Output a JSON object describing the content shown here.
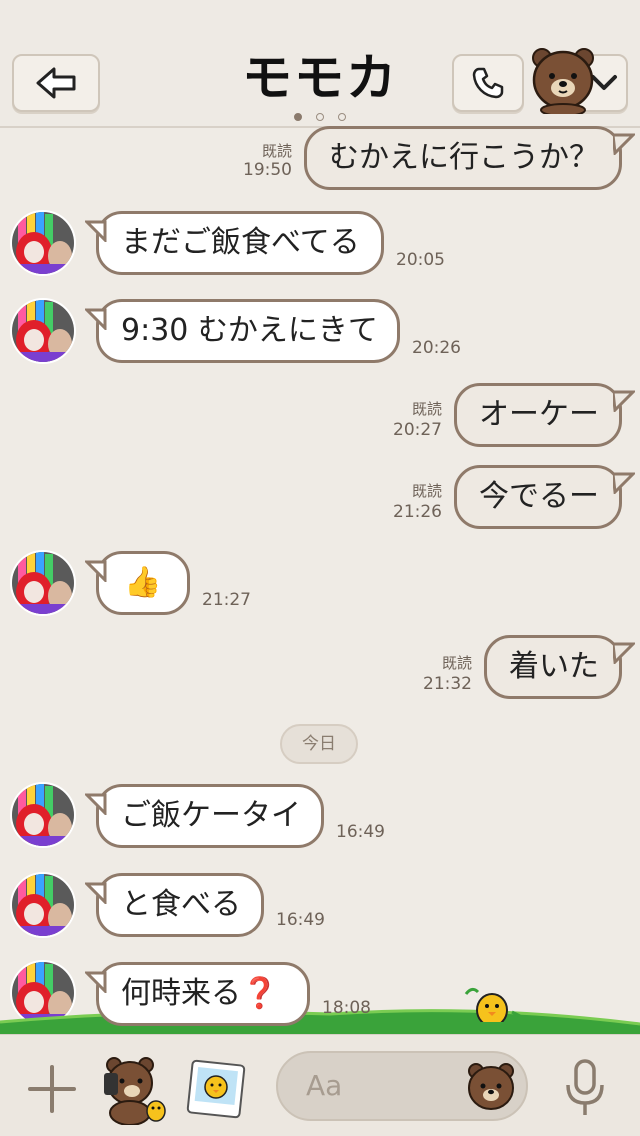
{
  "header": {
    "title": "モモカ",
    "back_icon": "back-arrow-icon",
    "call_icon": "phone-icon",
    "menu_icon": "chevron-down-icon",
    "pager_count": 3,
    "pager_active": 0
  },
  "messages": [
    {
      "dir": "out",
      "text": "むかえに行こうか？",
      "read": "既読",
      "time": "19:50"
    },
    {
      "dir": "in",
      "text": "まだご飯食べてる",
      "time": "20:05"
    },
    {
      "dir": "in",
      "text": "9:30 むかえにきて",
      "time": "20:26"
    },
    {
      "dir": "out",
      "text": "オーケー",
      "read": "既読",
      "time": "20:27"
    },
    {
      "dir": "out",
      "text": "今でるー",
      "read": "既読",
      "time": "21:26"
    },
    {
      "dir": "in",
      "text": "👍",
      "time": "21:27"
    },
    {
      "dir": "out",
      "text": "着いた",
      "read": "既読",
      "time": "21:32"
    },
    {
      "dir": "in",
      "text": "ご飯ケータイ",
      "time": "16:49"
    },
    {
      "dir": "in",
      "text": "と食べる",
      "time": "16:49"
    },
    {
      "dir": "in",
      "text": "何時来る❓",
      "time": "18:08"
    }
  ],
  "date_separator": "今日",
  "composer": {
    "placeholder": "Aa",
    "plus_icon": "plus-icon",
    "sticker_icon": "sticker-icon",
    "photo_icon": "photo-icon",
    "emoji_icon": "emoji-icon",
    "mic_icon": "microphone-icon"
  },
  "colors": {
    "background": "#efebe5",
    "bubble_border": "#8f7a6a",
    "grass": "#3aa33a"
  }
}
